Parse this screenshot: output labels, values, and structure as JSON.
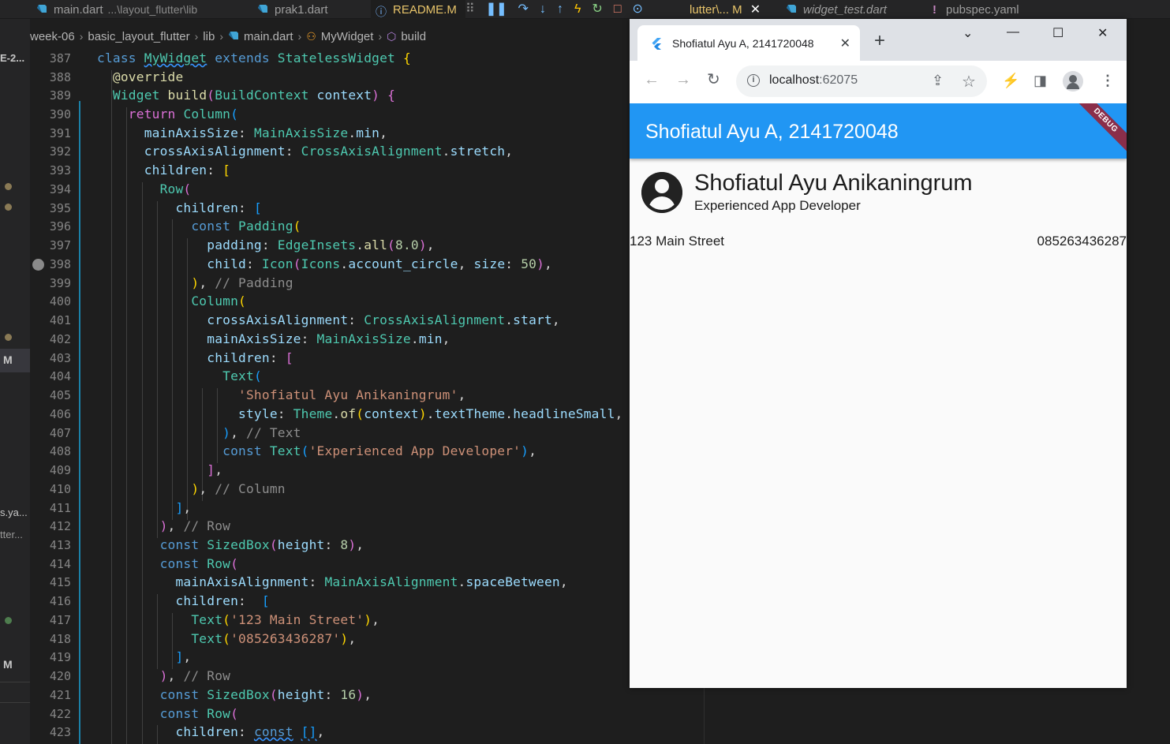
{
  "vscode": {
    "tabs": [
      {
        "label": "main.dart",
        "extra": "...\\layout_flutter\\lib",
        "icon": "dart-icon"
      },
      {
        "label": "prak1.dart",
        "icon": "dart-icon"
      },
      {
        "label": "README.M",
        "icon": "info-icon"
      },
      {
        "label": "lutter\\...  M",
        "icon": "dart-icon"
      },
      {
        "label": "widget_test.dart",
        "icon": "dart-icon"
      },
      {
        "label": "pubspec.yaml",
        "icon": "yaml-icon"
      }
    ],
    "breadcrumb": [
      "week-06",
      "basic_layout_flutter",
      "lib",
      "main.dart",
      "MyWidget",
      "build"
    ],
    "sidebar": {
      "label_top": "E-2...",
      "label_m1": "M",
      "label_yaml": "s.ya...",
      "label_flutter": "tter...",
      "label_m2": "M"
    },
    "line_numbers": [
      "387",
      "388",
      "389",
      "390",
      "391",
      "392",
      "393",
      "394",
      "395",
      "396",
      "397",
      "398",
      "399",
      "400",
      "401",
      "402",
      "403",
      "404",
      "405",
      "406",
      "407",
      "408",
      "409",
      "410",
      "411",
      "412",
      "413",
      "414",
      "415",
      "416",
      "417",
      "418",
      "419",
      "420",
      "421",
      "422",
      "423"
    ]
  },
  "browser": {
    "tab_title": "Shofiatul Ayu A, 2141720048",
    "url_host": "localhost",
    "url_port": ":62075",
    "icons": [
      "back-icon",
      "forward-icon",
      "reload-icon",
      "share-icon",
      "star-icon",
      "extension-icon",
      "sidepanel-icon",
      "profile-icon",
      "menu-icon"
    ]
  },
  "app": {
    "appbar_title": "Shofiatul Ayu A, 2141720048",
    "debug_banner": "DEBUG",
    "name": "Shofiatul Ayu Anikaningrum",
    "role": "Experienced App Developer",
    "address": "123 Main Street",
    "phone": "085263436287",
    "primary_color": "#2196f3"
  }
}
